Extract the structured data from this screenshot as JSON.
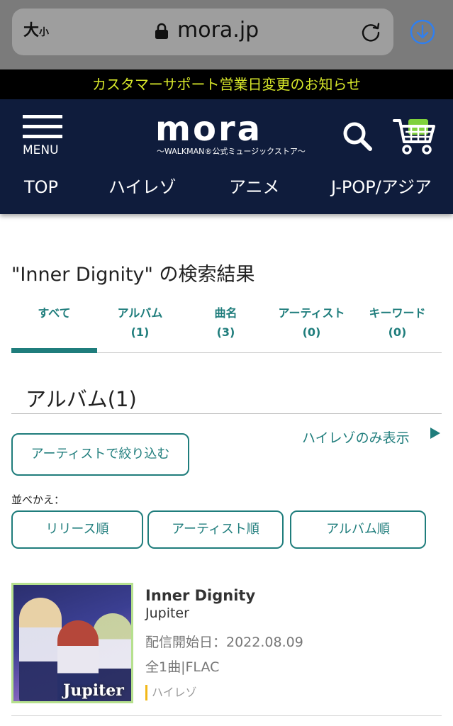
{
  "browser": {
    "text_size_large": "大",
    "text_size_small": "小",
    "url": "mora.jp"
  },
  "notice": "カスタマーサポート営業日変更のお知らせ",
  "header": {
    "menu_label": "MENU",
    "logo_text": "mora",
    "logo_sub": "〜WALKMAN®公式ミュージックストア〜",
    "nav": [
      "TOP",
      "ハイレゾ",
      "アニメ",
      "J-POP/アジア"
    ]
  },
  "results": {
    "title": "\"Inner Dignity\" の検索結果",
    "tabs": [
      {
        "label": "すべて",
        "count": ""
      },
      {
        "label": "アルバム",
        "count": "(1)"
      },
      {
        "label": "曲名",
        "count": "(3)"
      },
      {
        "label": "アーティスト",
        "count": "(0)"
      },
      {
        "label": "キーワード",
        "count": "(0)"
      }
    ],
    "section_heading": "アルバム(1)",
    "artist_filter_label": "アーティストで絞り込む",
    "hires_only_label": "ハイレゾのみ表示",
    "sort_label": "並べかえ：",
    "sort_options": [
      "リリース順",
      "アーティスト順",
      "アルバム順"
    ]
  },
  "album": {
    "title": "Inner Dignity",
    "artist": "Jupiter",
    "release": "配信開始日：2022.08.09",
    "format": "全1曲|FLAC",
    "badge": "ハイレゾ",
    "art_caption": "Jupiter"
  },
  "colors": {
    "accent": "#1f7d7c",
    "header_bg": "#0f1c3c",
    "notice_text": "#d8e82a",
    "cart_green": "#7fd13b",
    "download_blue": "#2f7ff0",
    "badge_yellow": "#f2b818"
  },
  "icons": [
    "lock-icon",
    "reload-icon",
    "download-icon",
    "menu-icon",
    "search-icon",
    "cart-icon",
    "play-triangle-icon"
  ]
}
